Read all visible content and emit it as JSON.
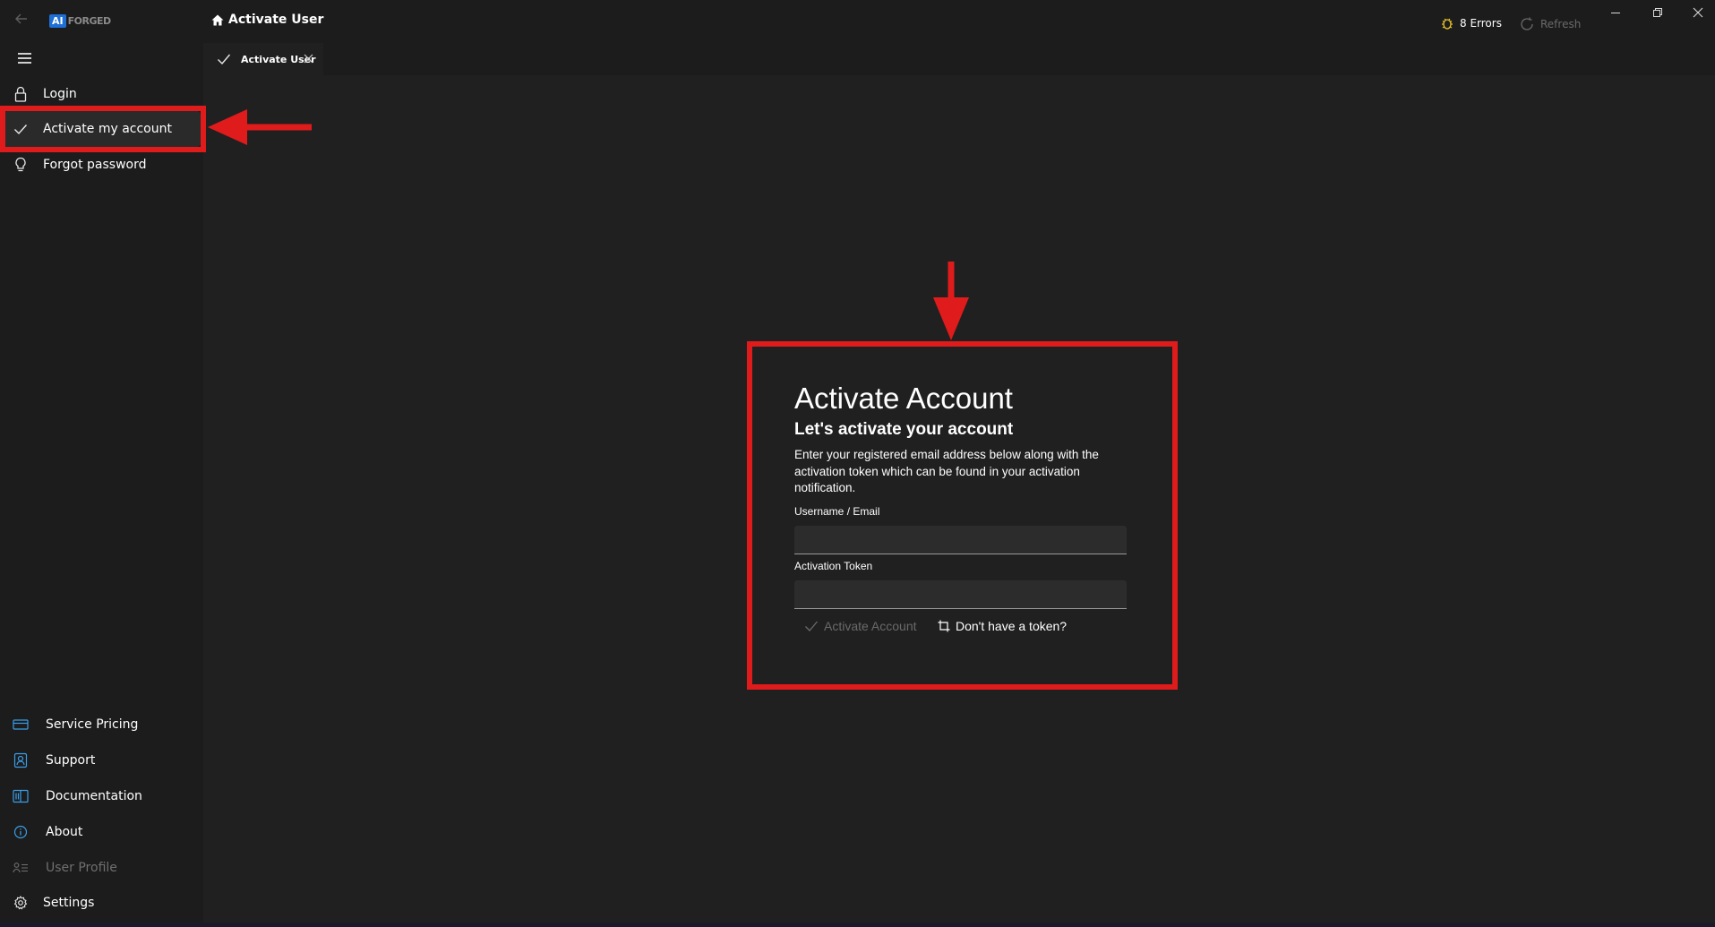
{
  "app": {
    "logo_ai": "AI",
    "logo_text": "FORGED"
  },
  "header": {
    "breadcrumb": "Activate User",
    "errors_label": "8 Errors",
    "refresh_label": "Refresh"
  },
  "tabs": [
    {
      "label": "Activate User"
    }
  ],
  "sidebar": {
    "top_items": [
      {
        "label": "Login",
        "icon": "lock-icon"
      },
      {
        "label": "Activate my account",
        "icon": "checkmark-icon",
        "selected": true
      },
      {
        "label": "Forgot password",
        "icon": "lightbulb-icon"
      }
    ],
    "bottom_items": [
      {
        "label": "Service Pricing",
        "icon": "card-icon"
      },
      {
        "label": "Support",
        "icon": "support-icon"
      },
      {
        "label": "Documentation",
        "icon": "book-icon"
      },
      {
        "label": "About",
        "icon": "info-icon"
      },
      {
        "label": "User Profile",
        "icon": "user-profile-icon",
        "disabled": true
      },
      {
        "label": "Settings",
        "icon": "gear-icon"
      }
    ]
  },
  "form": {
    "title": "Activate Account",
    "subtitle": "Let's activate your account",
    "description": "Enter your registered email address below along with the activation token which can be found in your activation notification.",
    "username_label": "Username / Email",
    "username_value": "",
    "token_label": "Activation Token",
    "token_value": "",
    "activate_button": "Activate Account",
    "no_token_button": "Don't have a token?"
  },
  "colors": {
    "annotation_red": "#e01b1b",
    "accent_blue": "#3a9ee8",
    "error_yellow": "#e8c32a"
  }
}
